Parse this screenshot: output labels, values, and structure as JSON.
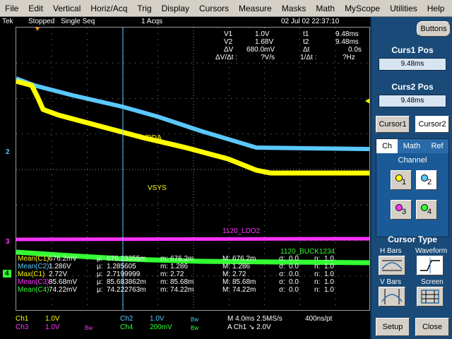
{
  "menu": [
    "File",
    "Edit",
    "Vertical",
    "Horiz/Acq",
    "Trig",
    "Display",
    "Cursors",
    "Measure",
    "Masks",
    "Math",
    "MyScope",
    "Utilities",
    "Help"
  ],
  "status": {
    "brand": "Tek",
    "state": "Stopped",
    "mode": "Single Seq",
    "acqs": "1 Acqs",
    "datetime": "02 Jul 02 22:37:10"
  },
  "cursor_readout": {
    "v1_label": "V1",
    "v1_val": "1.0V",
    "v2_label": "V2",
    "v2_val": "1.68V",
    "dv_label": "ΔV",
    "dv_val": "680.0mV",
    "dvdt_label": "ΔV/Δt :",
    "dvdt_val": "?V/s",
    "t1_label": "t1",
    "t1_val": "9.48ms",
    "t2_label": "t2",
    "t2_val": "9.48ms",
    "dt_label": "Δt",
    "dt_val": "0.0s",
    "inv_dt_label": "1/Δt :",
    "inv_dt_val": "?Hz"
  },
  "trace_labels": {
    "vdda": "VDDA",
    "vsys": "VSYS",
    "ldo2": "1120_LDO2",
    "buck": "1120_BUCK1234"
  },
  "ground_markers": {
    "ch2": "2",
    "ch3": "3",
    "ch4": "4"
  },
  "measurements": [
    {
      "name": "Mean(C1)",
      "value": "676.2mV",
      "mu": "676.23355m",
      "m": "676.2m",
      "M": "676.2m",
      "sigma": "0.0",
      "n": "1.0",
      "color": "#ffff00"
    },
    {
      "name": "Mean(C2)",
      "value": "1.286V",
      "mu": "1.285605",
      "m": "1.286",
      "M": "1.286",
      "sigma": "0.0",
      "n": "1.0",
      "color": "#5ac8ff"
    },
    {
      "name": "Max(C1)",
      "value": "2.72V",
      "mu": "2.7199999",
      "m": "2.72",
      "M": "2.72",
      "sigma": "0.0",
      "n": "1.0",
      "color": "#ffff00"
    },
    {
      "name": "Mean(C3)",
      "value": "85.68mV",
      "mu": "85.683862m",
      "m": "85.68m",
      "M": "85.68m",
      "sigma": "0.0",
      "n": "1.0",
      "color": "#ff33ff"
    },
    {
      "name": "Mean(C4)",
      "value": "74.22mV",
      "mu": "74.222763m",
      "m": "74.22m",
      "M": "74.22m",
      "sigma": "0.0",
      "n": "1.0",
      "color": "#33ff33"
    }
  ],
  "meas_prefix": {
    "mu": "μ:",
    "m": "m:",
    "M": "M:",
    "sigma": "σ:",
    "n": "n:"
  },
  "channels": {
    "ch1_label": "Ch1",
    "ch1_scale": "1.0V",
    "ch2_label": "Ch2",
    "ch2_scale": "1.0V",
    "ch2_bw": "Bw",
    "ch3_label": "Ch3",
    "ch3_scale": "1.0V",
    "ch3_bw": "Bw",
    "ch4_label": "Ch4",
    "ch4_scale": "200mV",
    "ch4_bw": "Bw",
    "timebase": "M 4.0ms 2.5MS/s",
    "record": "400ns/pt",
    "trigger": "A  Ch1  ↘  2.0V"
  },
  "panel": {
    "buttons_label": "Buttons",
    "curs1_title": "Curs1 Pos",
    "curs1_val": "9.48ms",
    "curs2_title": "Curs2 Pos",
    "curs2_val": "9.48ms",
    "cursor1_btn": "Cursor1",
    "cursor2_btn": "Cursor2",
    "tabs": [
      "Ch",
      "Math",
      "Ref"
    ],
    "channel_label": "Channel",
    "ch_buttons": [
      "1",
      "2",
      "3",
      "4"
    ],
    "cursor_type_title": "Cursor Type",
    "hbars": "H Bars",
    "waveform": "Waveform",
    "vbars": "V Bars",
    "screen": "Screen",
    "setup": "Setup",
    "close": "Close"
  },
  "colors": {
    "ch1": "#ffff00",
    "ch2": "#5ac8ff",
    "ch3": "#ff33ff",
    "ch4": "#33ff33",
    "panel": "#1a4a78"
  }
}
